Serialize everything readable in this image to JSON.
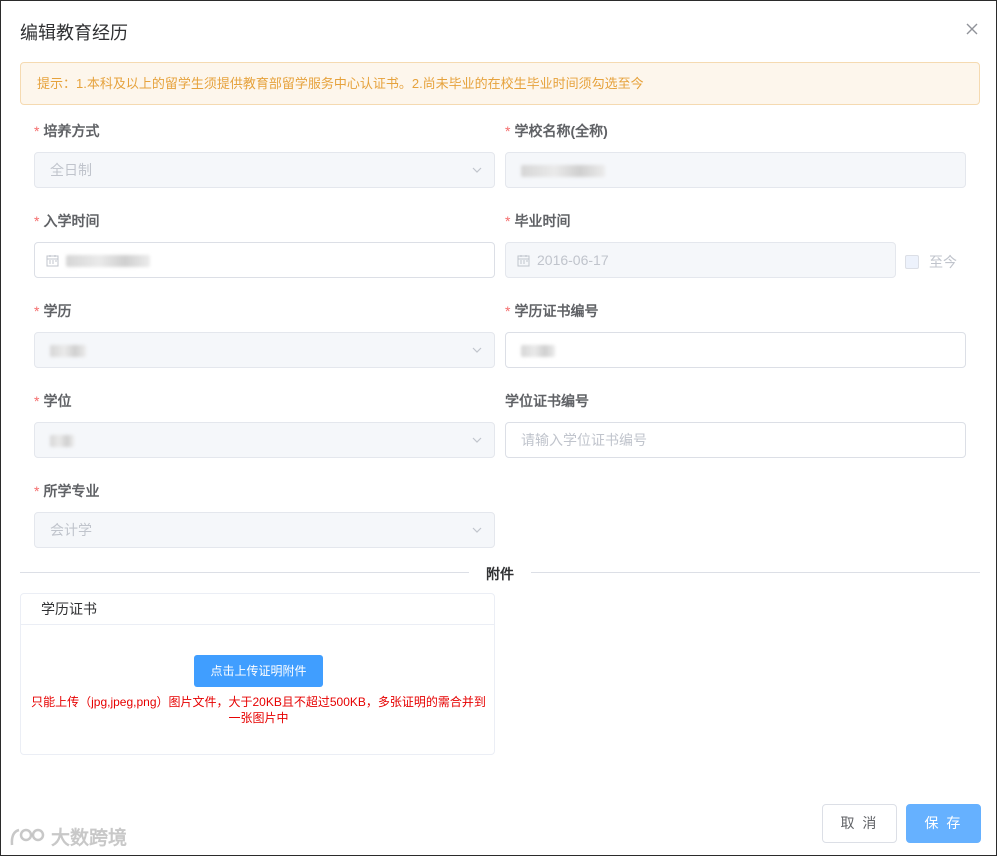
{
  "dialog": {
    "title": "编辑教育经历",
    "alert": "提示：1.本科及以上的留学生须提供教育部留学服务中心认证书。2.尚未毕业的在校生毕业时间须勾选至今"
  },
  "form": {
    "training_mode": {
      "label": "培养方式",
      "value": "全日制"
    },
    "school_name": {
      "label": "学校名称(全称)"
    },
    "enroll_date": {
      "label": "入学时间"
    },
    "graduate_date": {
      "label": "毕业时间",
      "value": "2016-06-17",
      "until_now_label": "至今"
    },
    "education": {
      "label": "学历"
    },
    "education_cert": {
      "label": "学历证书编号"
    },
    "degree": {
      "label": "学位"
    },
    "degree_cert": {
      "label": "学位证书编号",
      "placeholder": "请输入学位证书编号"
    },
    "major": {
      "label": "所学专业",
      "value": "会计学"
    },
    "required_mark": "*"
  },
  "attachments": {
    "divider_label": "附件",
    "card_title": "学历证书",
    "upload_button": "点击上传证明附件",
    "upload_note": "只能上传（jpg,jpeg,png）图片文件，大于20KB且不超过500KB，多张证明的需合并到一张图片中"
  },
  "footer": {
    "cancel": "取 消",
    "save": "保 存"
  },
  "watermark": "大数跨境",
  "colors": {
    "primary": "#409eff",
    "save_button": "#66b1ff",
    "warning_text": "#e6a23c",
    "warning_bg": "#fdf6ec",
    "required": "#f56c6c",
    "note_red": "#e60000"
  }
}
